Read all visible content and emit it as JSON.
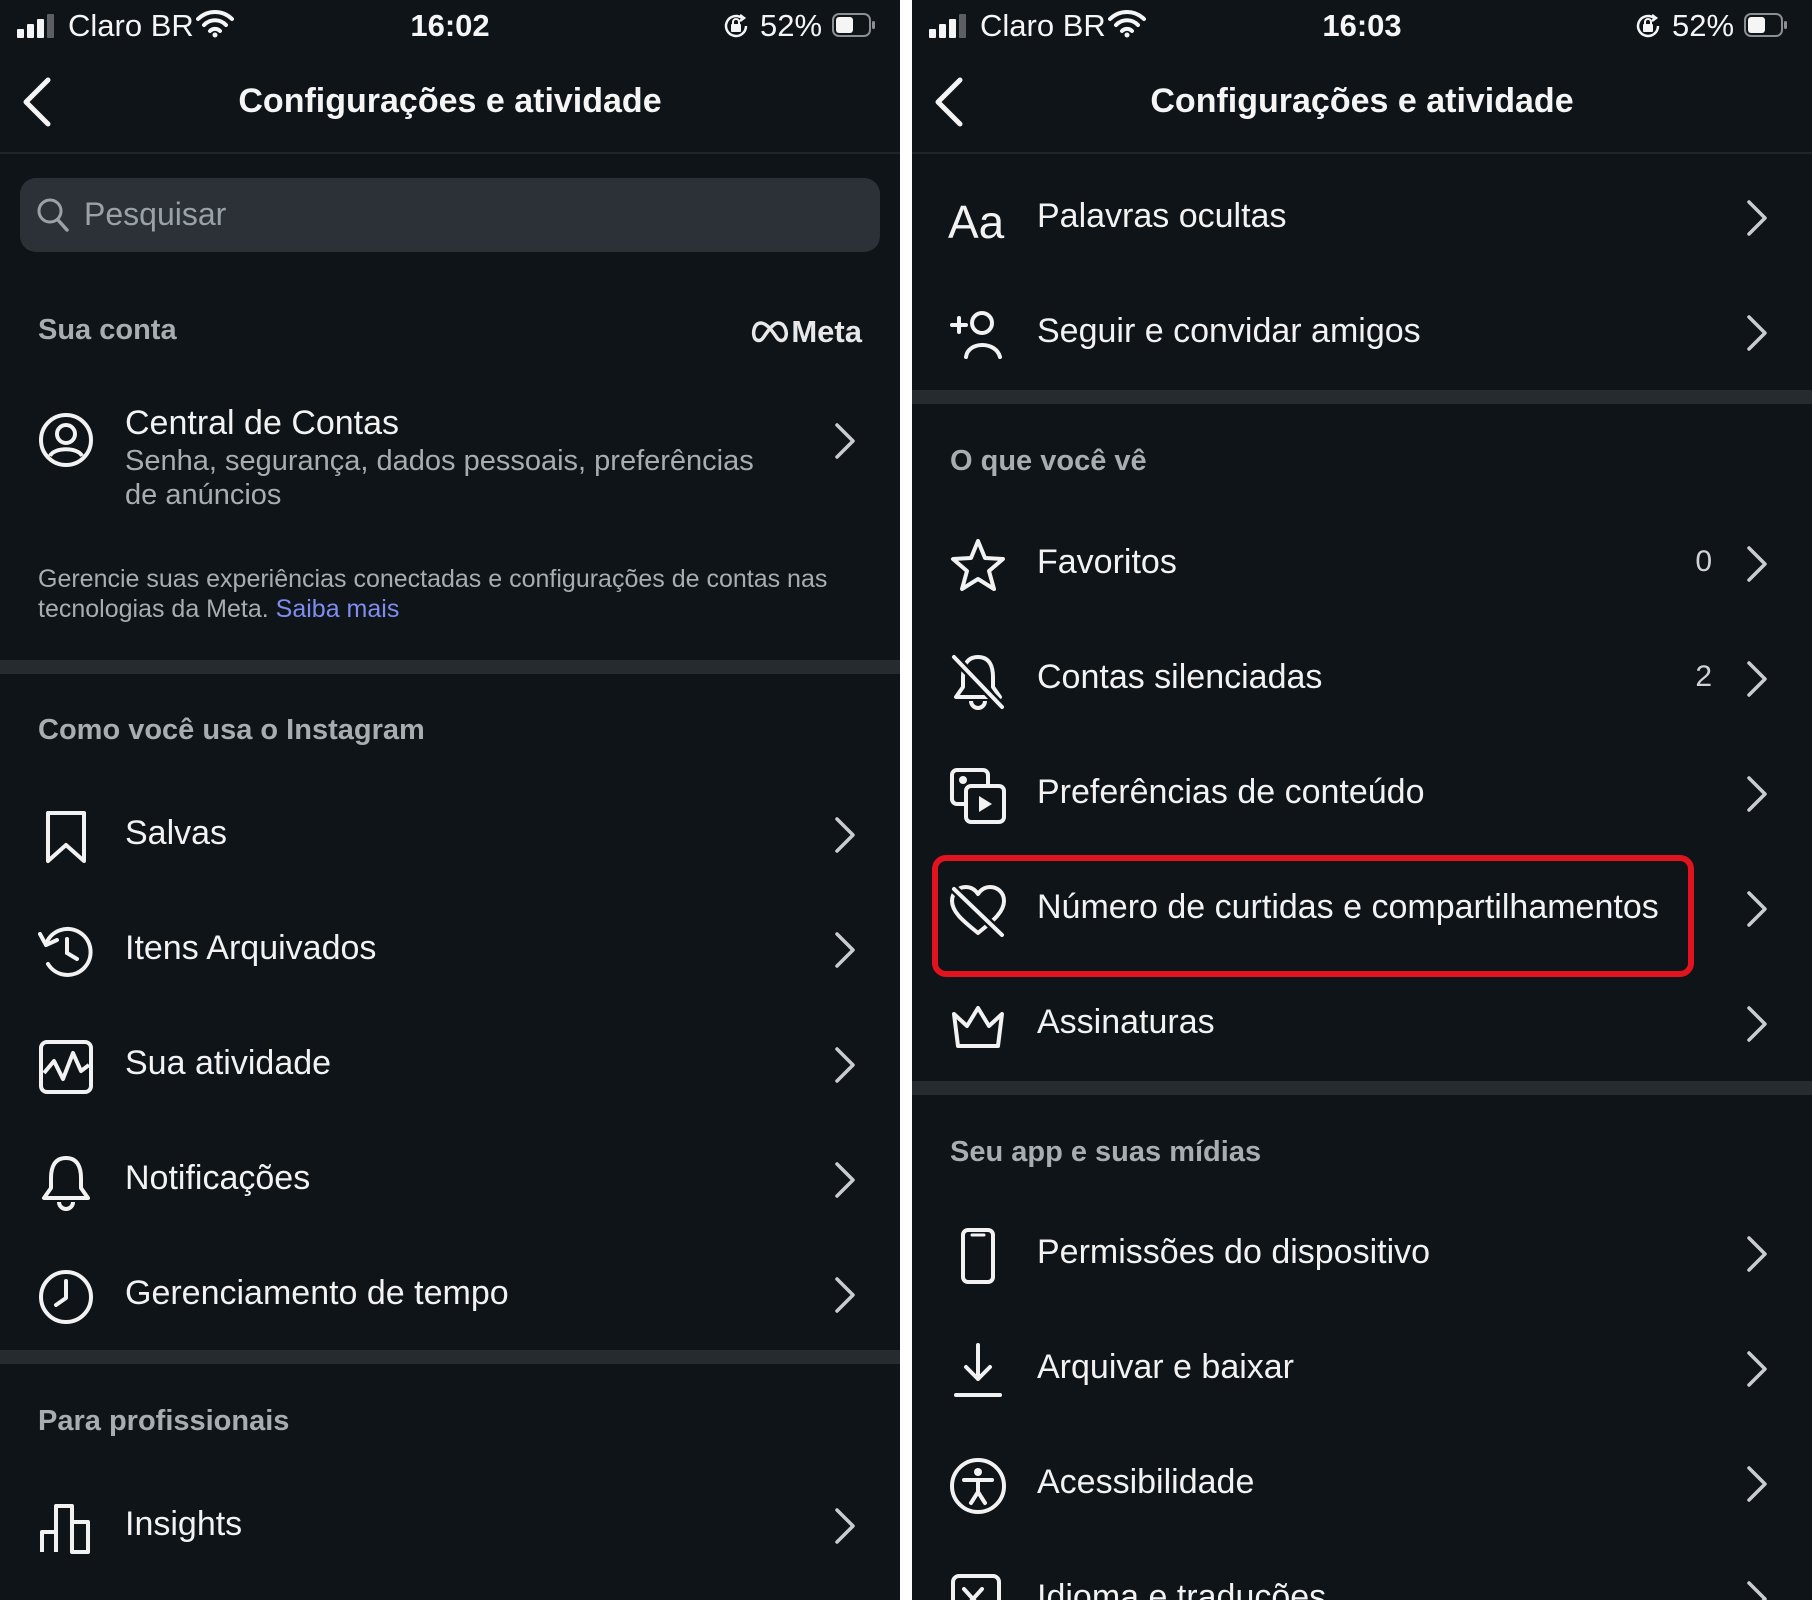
{
  "left": {
    "status": {
      "carrier": "Claro BR",
      "time": "16:02",
      "battery": "52%"
    },
    "nav": {
      "title": "Configurações e atividade"
    },
    "search": {
      "placeholder": "Pesquisar"
    },
    "account_section": {
      "label": "Sua conta",
      "brand": "Meta",
      "center": {
        "title": "Central de Contas",
        "subtitle": "Senha, segurança, dados pessoais, preferências de anúncios",
        "icon": "account-circle-icon"
      },
      "description": "Gerencie suas experiências conectadas e configurações de contas nas tecnologias da Meta.",
      "learn_more": "Saiba mais"
    },
    "usage_section": {
      "label": "Como você usa o Instagram",
      "items": [
        {
          "label": "Salvas",
          "icon": "bookmark-icon"
        },
        {
          "label": "Itens Arquivados",
          "icon": "archive-history-icon"
        },
        {
          "label": "Sua atividade",
          "icon": "activity-icon"
        },
        {
          "label": "Notificações",
          "icon": "bell-icon"
        },
        {
          "label": "Gerenciamento de tempo",
          "icon": "clock-icon"
        }
      ]
    },
    "pro_section": {
      "label": "Para profissionais",
      "items": [
        {
          "label": "Insights",
          "icon": "bar-chart-icon"
        }
      ]
    }
  },
  "right": {
    "status": {
      "carrier": "Claro BR",
      "time": "16:03",
      "battery": "52%"
    },
    "nav": {
      "title": "Configurações e atividade"
    },
    "top_items": [
      {
        "label": "Palavras ocultas",
        "icon": "text-aa-icon"
      },
      {
        "label": "Seguir e convidar amigos",
        "icon": "add-person-icon"
      }
    ],
    "see_section": {
      "label": "O que você vê",
      "items": [
        {
          "label": "Favoritos",
          "icon": "star-icon",
          "count": "0"
        },
        {
          "label": "Contas silenciadas",
          "icon": "bell-off-icon",
          "count": "2"
        },
        {
          "label": "Preferências de conteúdo",
          "icon": "media-play-icon"
        },
        {
          "label": "Número de curtidas e compartilhamentos",
          "icon": "heart-off-icon",
          "highlighted": true
        },
        {
          "label": "Assinaturas",
          "icon": "crown-icon"
        }
      ]
    },
    "app_section": {
      "label": "Seu app e suas mídias",
      "items": [
        {
          "label": "Permissões do dispositivo",
          "icon": "phone-icon"
        },
        {
          "label": "Arquivar e baixar",
          "icon": "download-icon"
        },
        {
          "label": "Acessibilidade",
          "icon": "accessibility-icon"
        },
        {
          "label": "Idioma e traduções",
          "icon": "translate-icon"
        }
      ]
    },
    "highlight_color": "#e0131f"
  },
  "colors": {
    "background": "#0f1418",
    "link": "#7f8cf0",
    "divider": "#262b30"
  }
}
